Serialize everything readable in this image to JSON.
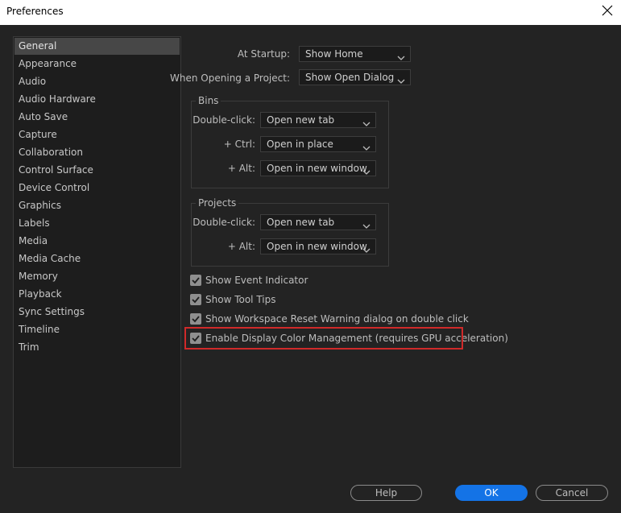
{
  "window": {
    "title": "Preferences"
  },
  "sidebar": {
    "items": [
      {
        "label": "General",
        "selected": true
      },
      {
        "label": "Appearance"
      },
      {
        "label": "Audio"
      },
      {
        "label": "Audio Hardware"
      },
      {
        "label": "Auto Save"
      },
      {
        "label": "Capture"
      },
      {
        "label": "Collaboration"
      },
      {
        "label": "Control Surface"
      },
      {
        "label": "Device Control"
      },
      {
        "label": "Graphics"
      },
      {
        "label": "Labels"
      },
      {
        "label": "Media"
      },
      {
        "label": "Media Cache"
      },
      {
        "label": "Memory"
      },
      {
        "label": "Playback"
      },
      {
        "label": "Sync Settings"
      },
      {
        "label": "Timeline"
      },
      {
        "label": "Trim"
      }
    ]
  },
  "general": {
    "at_startup": {
      "label": "At Startup:",
      "value": "Show Home"
    },
    "when_opening": {
      "label": "When Opening a Project:",
      "value": "Show Open Dialog"
    },
    "bins": {
      "title": "Bins",
      "double_click": {
        "label": "Double-click:",
        "value": "Open new tab"
      },
      "ctrl": {
        "label": "+ Ctrl:",
        "value": "Open in place"
      },
      "alt": {
        "label": "+ Alt:",
        "value": "Open in new window"
      }
    },
    "projects": {
      "title": "Projects",
      "double_click": {
        "label": "Double-click:",
        "value": "Open new tab"
      },
      "alt": {
        "label": "+ Alt:",
        "value": "Open in new window"
      }
    },
    "checkboxes": [
      {
        "label": "Show Event Indicator",
        "checked": true
      },
      {
        "label": "Show Tool Tips",
        "checked": true
      },
      {
        "label": "Show Workspace Reset Warning dialog on double click",
        "checked": true
      },
      {
        "label": "Enable Display Color Management (requires GPU acceleration)",
        "checked": true
      }
    ]
  },
  "buttons": {
    "help": "Help",
    "ok": "OK",
    "cancel": "Cancel"
  },
  "colors": {
    "accent": "#1473e6",
    "highlight": "#d02a2a",
    "background": "#232323"
  }
}
